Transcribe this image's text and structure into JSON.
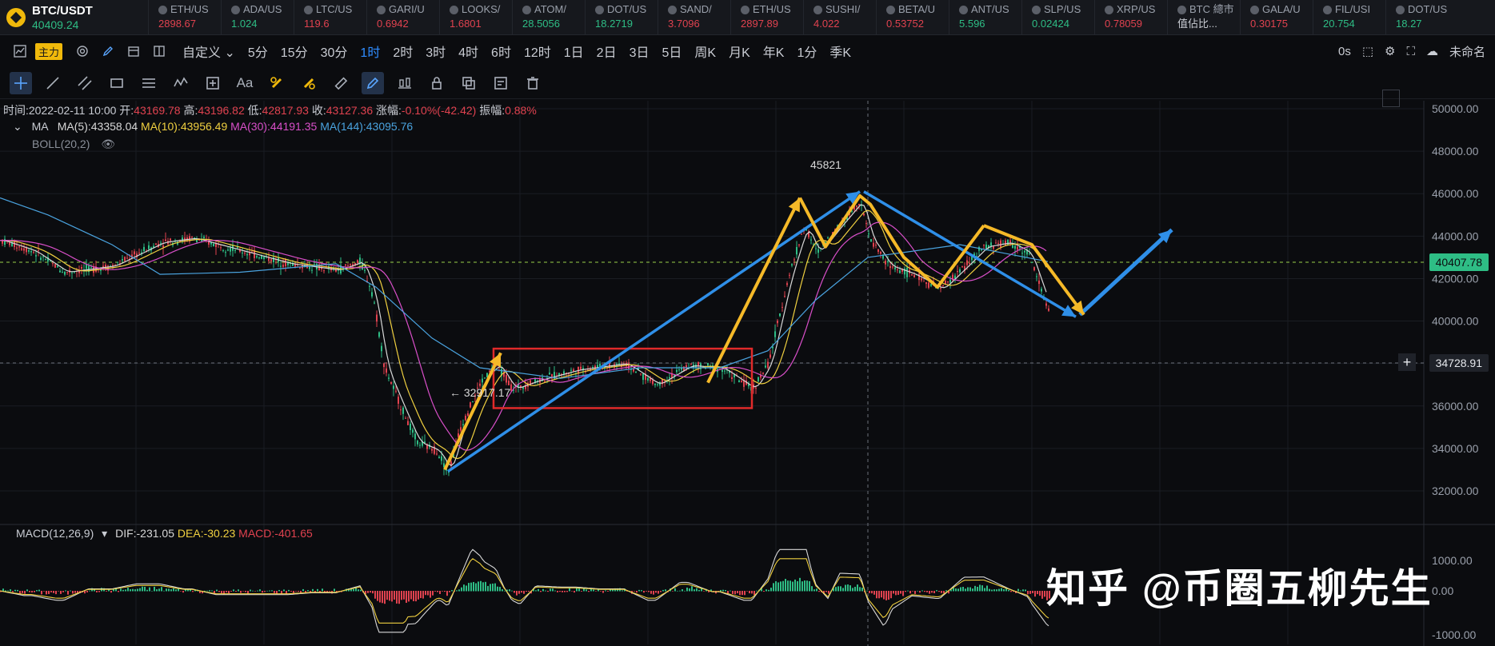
{
  "ticker": {
    "main": {
      "pair": "BTC/USDT",
      "price": "40409.24"
    },
    "items": [
      {
        "name": "ETH/US",
        "value": "2898.67",
        "dir": "down"
      },
      {
        "name": "ADA/US",
        "value": "1.024",
        "dir": "up"
      },
      {
        "name": "LTC/US",
        "value": "119.6",
        "dir": "down"
      },
      {
        "name": "GARI/U",
        "value": "0.6942",
        "dir": "down"
      },
      {
        "name": "LOOKS/",
        "value": "1.6801",
        "dir": "down"
      },
      {
        "name": "ATOM/",
        "value": "28.5056",
        "dir": "up"
      },
      {
        "name": "DOT/US",
        "value": "18.2719",
        "dir": "up"
      },
      {
        "name": "SAND/",
        "value": "3.7096",
        "dir": "down"
      },
      {
        "name": "ETH/US",
        "value": "2897.89",
        "dir": "down"
      },
      {
        "name": "SUSHI/",
        "value": "4.022",
        "dir": "down"
      },
      {
        "name": "BETA/U",
        "value": "0.53752",
        "dir": "down"
      },
      {
        "name": "ANT/US",
        "value": "5.596",
        "dir": "up"
      },
      {
        "name": "SLP/US",
        "value": "0.02424",
        "dir": "up"
      },
      {
        "name": "XRP/US",
        "value": "0.78059",
        "dir": "down"
      },
      {
        "name": "BTC 總市",
        "value": "值佔比...",
        "dir": "white"
      },
      {
        "name": "GALA/U",
        "value": "0.30175",
        "dir": "down"
      },
      {
        "name": "FIL/USI",
        "value": "20.754",
        "dir": "up"
      },
      {
        "name": "DOT/US",
        "value": "18.27",
        "dir": "up"
      }
    ]
  },
  "toolbar": {
    "main_badge": "主力",
    "custom": "自定义",
    "timeframes": [
      "5分",
      "15分",
      "30分",
      "1时",
      "2时",
      "3时",
      "4时",
      "6时",
      "12时",
      "1日",
      "2日",
      "3日",
      "5日",
      "周K",
      "月K",
      "年K",
      "1分",
      "季K"
    ],
    "active_timeframe": "1时",
    "countdown": "0s",
    "account": "未命名"
  },
  "drawing_tools": [
    "cursor-icon",
    "trendline-icon",
    "parallel-icon",
    "rectangle-icon",
    "fib-icon",
    "wave-icon",
    "measure-icon",
    "text-icon",
    "magnet-icon",
    "eraser-icon",
    "ruler-icon",
    "pen-icon",
    "layers-icon",
    "lock-icon",
    "copy-icon",
    "note-icon",
    "trash-icon"
  ],
  "ohlc": {
    "time_label": "时间:",
    "time": "2022-02-11 10:00",
    "open_label": "开:",
    "open": "43169.78",
    "high_label": "高:",
    "high": "43196.82",
    "low_label": "低:",
    "low": "42817.93",
    "close_label": "收:",
    "close": "43127.36",
    "change_label": "涨幅:",
    "change": "-0.10%(-42.42)",
    "amp_label": "振幅:",
    "amp": "0.88%"
  },
  "indicators": {
    "ma_title": "MA",
    "ma5": "MA(5):43358.04",
    "ma10": "MA(10):43956.49",
    "ma30": "MA(30):44191.35",
    "ma144": "MA(144):43095.76",
    "boll": "BOLL(20,2)"
  },
  "macd": {
    "title": "MACD(12,26,9)",
    "dif": "DIF:-231.05",
    "dea": "DEA:-30.23",
    "macd": "MACD:-401.65",
    "axis": [
      "1000.00",
      "0.00",
      "-1000.00"
    ]
  },
  "price_axis": [
    "50000.00",
    "48000.00",
    "46000.00",
    "44000.00",
    "42000.00",
    "40000.00",
    "38000.00",
    "36000.00",
    "34000.00",
    "32000.00"
  ],
  "tags": {
    "current": "40407.78",
    "crosshair": "34728.91",
    "low_annotation": "← 32917.17",
    "high_annotation": "45821"
  },
  "colors": {
    "up": "#2ebd85",
    "down": "#e0424f",
    "ma5": "#d8d8d8",
    "ma10": "#f0d040",
    "ma30": "#d94fc9",
    "ma144": "#4aa3df",
    "arrow_blue": "#2f8fe8",
    "arrow_yellow": "#f5b928",
    "box": "#e02a2a"
  },
  "chart_data": {
    "type": "line",
    "ylim": [
      31000,
      50500
    ],
    "series": [
      {
        "name": "MA(5)",
        "values": []
      }
    ],
    "swing_points": [
      {
        "price": 32917.17
      },
      {
        "price": 45821
      }
    ]
  },
  "watermark": "知乎 @币圈五柳先生"
}
